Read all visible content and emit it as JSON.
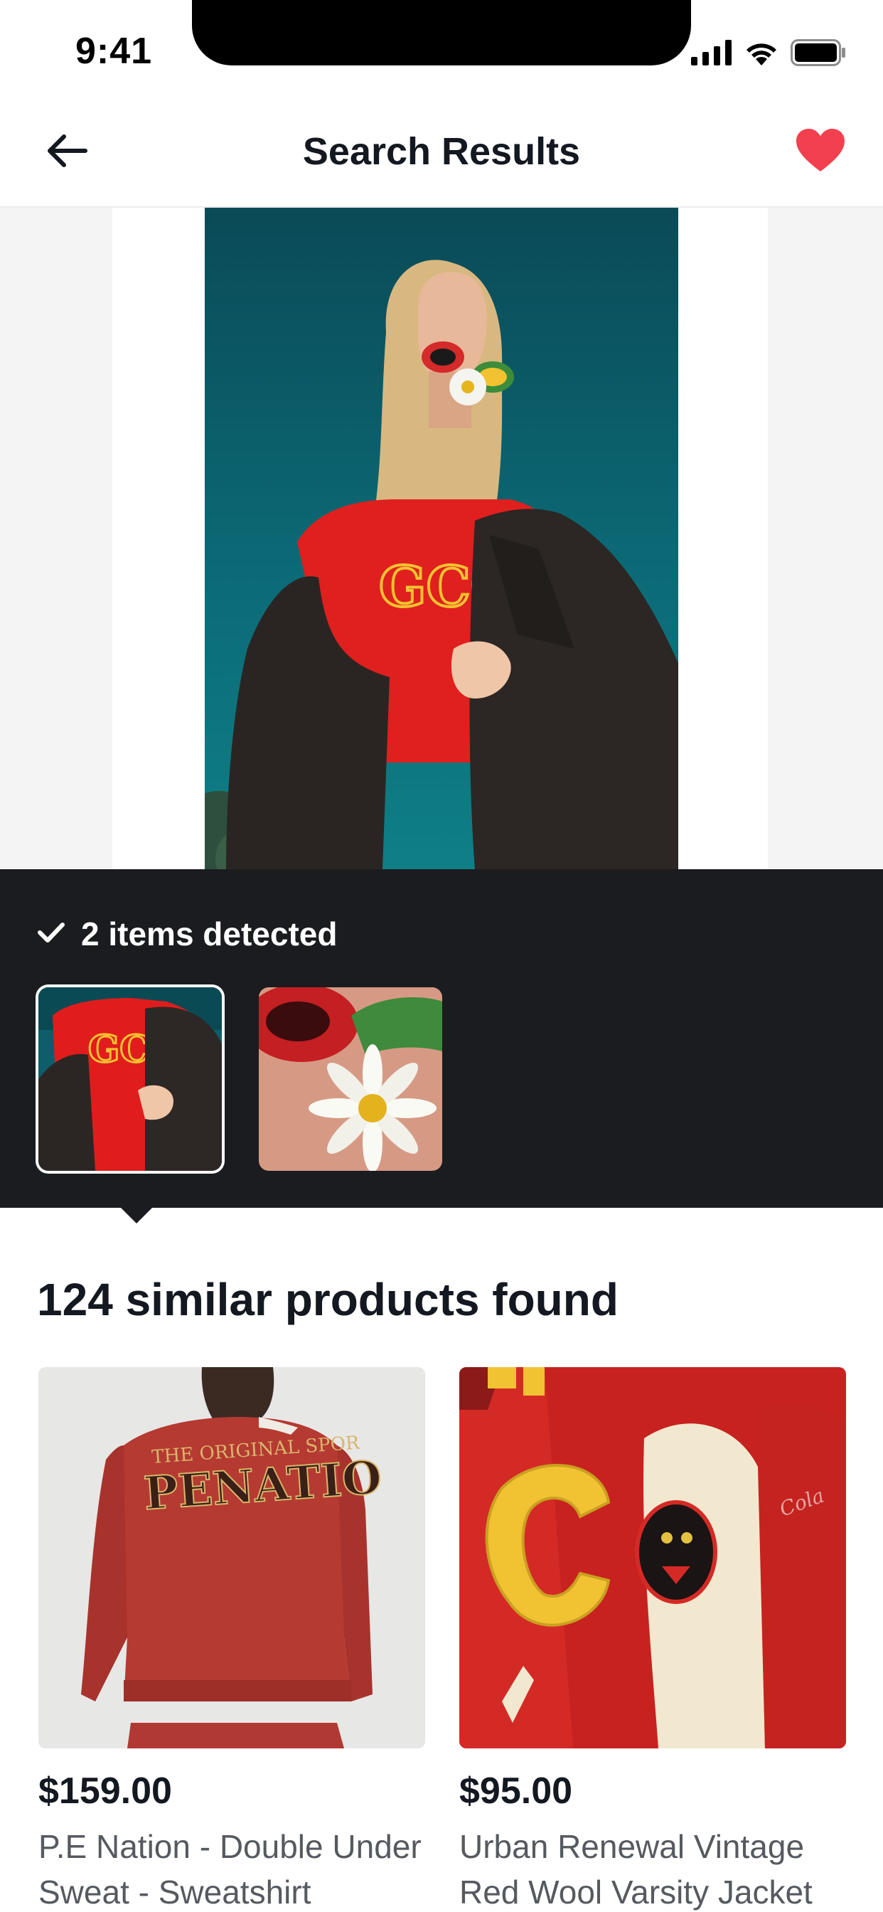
{
  "status_bar": {
    "time": "9:41"
  },
  "header": {
    "title": "Search Results",
    "back_icon": "arrow-left-icon",
    "favorite_icon": "heart-icon",
    "favorite_color": "#f2404f"
  },
  "detection": {
    "label": "2 items detected",
    "check_icon": "check-icon",
    "selected_index": 0,
    "thumbnails": [
      {
        "subject": "jacket-and-red-tee"
      },
      {
        "subject": "sunglasses-and-daisy"
      }
    ]
  },
  "results": {
    "title": "124 similar products found",
    "products": [
      {
        "price": "$159.00",
        "name": "P.E Nation - Double Under Sweat - Sweatshirt"
      },
      {
        "price": "$95.00",
        "name": "Urban Renewal Vintage Red Wool Varsity Jacket"
      }
    ]
  },
  "colors": {
    "panel_bg": "#1b1c1f",
    "text_primary": "#141820",
    "text_secondary": "#565a60",
    "accent_red": "#f2404f"
  }
}
